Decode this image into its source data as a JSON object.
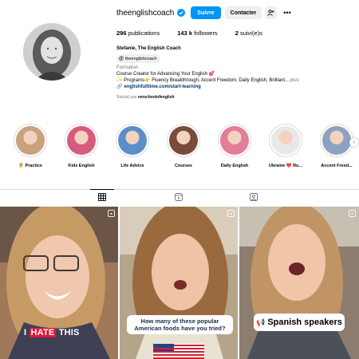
{
  "profile": {
    "username": "theenglishcoach",
    "follow_label": "Suivre",
    "contact_label": "Contacter",
    "more_label": "•••",
    "stats": {
      "posts_count": "296",
      "posts_label": "publications",
      "followers_count": "143 k",
      "followers_label": "followers",
      "following_count": "2",
      "following_label": "suivi(e)s"
    },
    "bio": {
      "name": "Stefanie, The English Coach",
      "threads_handle": "theenglishcoach",
      "category": "Formation",
      "line1": "Course Creator for Advancing Your English 💕",
      "line2": "✨ Programs👉 Fluency Breakthrough, Accent Freedom, Daily English, Brilliant...",
      "more": "plus",
      "link": "englishfulltime.com/start-learning",
      "followed_by_prefix": "Suivi(e) par",
      "followed_by_user": "emschoolofenglish"
    }
  },
  "highlights": [
    {
      "label": "🦻 Practice",
      "color": "#c9a27e"
    },
    {
      "label": "Kids English",
      "color": "#d85a7f"
    },
    {
      "label": "Life Advice",
      "color": "#5a8fc7"
    },
    {
      "label": "Courses",
      "color": "#7a4a3a"
    },
    {
      "label": "Daily English",
      "color": "#e27d9a"
    },
    {
      "label": "Ukraine ❤️ Ru...",
      "color": "#e8e8e8"
    },
    {
      "label": "Accent Freed...",
      "color": "#8aa3c0"
    }
  ],
  "tabs": {
    "posts_icon": "grid-icon",
    "reels_icon": "reels-icon",
    "tagged_icon": "tagged-icon"
  },
  "posts": [
    {
      "caption_pre": "I ",
      "caption_hl": "HATE",
      "caption_post": " THIS",
      "icon": "reel-icon"
    },
    {
      "caption": "How many of these popular American  foods have you tried?",
      "icon": "reel-icon"
    },
    {
      "caption": "Spanish speakers",
      "icon": "reel-icon"
    }
  ],
  "colors": {
    "accent": "#0095f6",
    "button_bg": "#efefef",
    "link": "#00376b",
    "muted": "#737373",
    "highlight_red": "#e0153a"
  }
}
